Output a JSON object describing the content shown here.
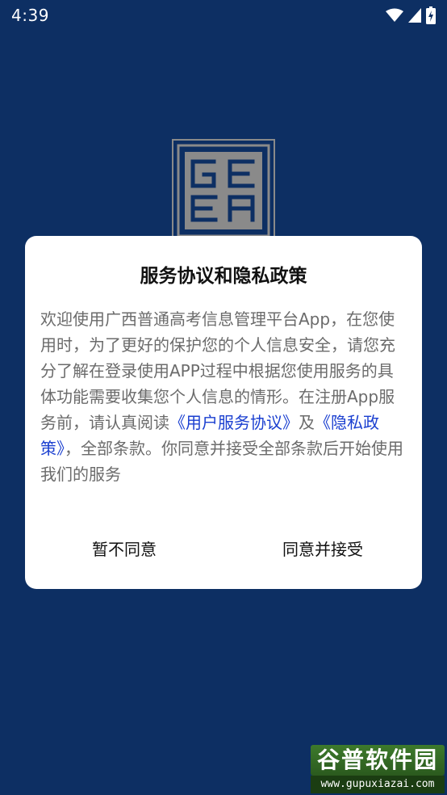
{
  "status_bar": {
    "time": "4:39",
    "icons": [
      "wifi-icon",
      "signal-icon",
      "battery-icon"
    ]
  },
  "logo": {
    "letters": [
      "G",
      "E",
      "E",
      "A"
    ]
  },
  "dialog": {
    "title": "服务协议和隐私政策",
    "body_part1": "欢迎使用广西普通高考信息管理平台App，在您使用时，为了更好的保护您的个人信息安全，请您充分了解在登录使用APP过程中根据您使用服务的具体功能需要收集您个人信息的情形。在注册App服务前，请认真阅读",
    "user_agreement_link": "《用户服务协议》",
    "body_and": "及",
    "privacy_policy_link": "《隐私政策》",
    "body_part2": "，全部条款。你同意并接受全部条款后开始使用我们的服务",
    "decline_label": "暂不同意",
    "accept_label": "同意并接受"
  },
  "watermark": {
    "title": "谷普软件园",
    "url": "www.gupuxiazai.com"
  },
  "colors": {
    "background": "#0d2f63",
    "dialog": "#ffffff",
    "link": "#1a3fd0",
    "body_text": "#6b6b6b"
  }
}
